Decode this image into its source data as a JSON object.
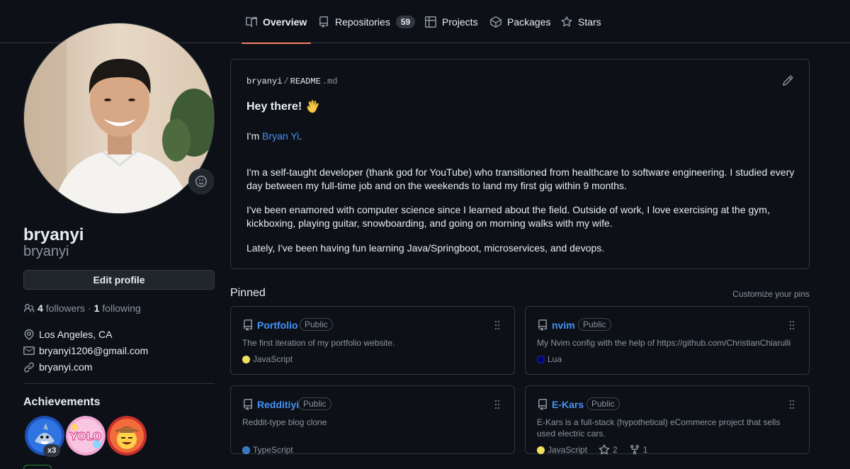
{
  "tabs": [
    {
      "label": "Overview",
      "icon": "book-icon",
      "active": true
    },
    {
      "label": "Repositories",
      "icon": "repo-icon",
      "count": "59"
    },
    {
      "label": "Projects",
      "icon": "table-icon"
    },
    {
      "label": "Packages",
      "icon": "package-icon"
    },
    {
      "label": "Stars",
      "icon": "star-icon"
    }
  ],
  "profile": {
    "name": "bryanyi",
    "login": "bryanyi",
    "edit_label": "Edit profile",
    "followers_count": "4",
    "followers_label": "followers",
    "separator": "·",
    "following_count": "1",
    "following_label": "following",
    "location": "Los Angeles, CA",
    "email": "bryanyi1206@gmail.com",
    "website": "bryanyi.com"
  },
  "achievements": {
    "title": "Achievements",
    "badges": [
      "shark-badge",
      "yolo-badge",
      "cowboy-badge"
    ],
    "multiplier": "x3"
  },
  "readme": {
    "owner": "bryanyi",
    "sep": "/",
    "file": "README",
    "ext": ".md",
    "heading": "Hey there!",
    "intro_prefix": "I'm ",
    "intro_link": "Bryan Yi",
    "intro_suffix": ".",
    "p1": "I'm a self-taught developer (thank god for YouTube) who transitioned from healthcare to software engineering. I studied every day between my full-time job and on the weekends to land my first gig within 9 months.",
    "p2": "I've been enamored with computer science since I learned about the field. Outside of work, I love exercising at the gym, kickboxing, playing guitar, snowboarding, and going on morning walks with my wife.",
    "p3": "Lately, I've been having fun learning Java/Springboot, microservices, and devops."
  },
  "pinned": {
    "title": "Pinned",
    "customize": "Customize your pins",
    "cards": [
      {
        "name": "Portfolio",
        "visibility": "Public",
        "description": "The first iteration of my portfolio website.",
        "language": "JavaScript",
        "lang_color": "#f1e05a"
      },
      {
        "name": "nvim",
        "visibility": "Public",
        "description": "My Nvim config with the help of https://github.com/ChristianChiarulli",
        "language": "Lua",
        "lang_color": "#000080"
      },
      {
        "name": "Redditiyi",
        "visibility": "Public",
        "description": "Reddit-type blog clone",
        "language": "TypeScript",
        "lang_color": "#3178c6"
      },
      {
        "name": "E-Kars",
        "visibility": "Public",
        "description": "E-Kars is a full-stack (hypothetical) eCommerce project that sells used electric cars.",
        "language": "JavaScript",
        "lang_color": "#f1e05a",
        "stars": "2",
        "forks": "1"
      }
    ]
  },
  "colors": {
    "accent": "#f78166",
    "link": "#4493f8",
    "bg": "#0d1117",
    "border": "#30363d"
  }
}
